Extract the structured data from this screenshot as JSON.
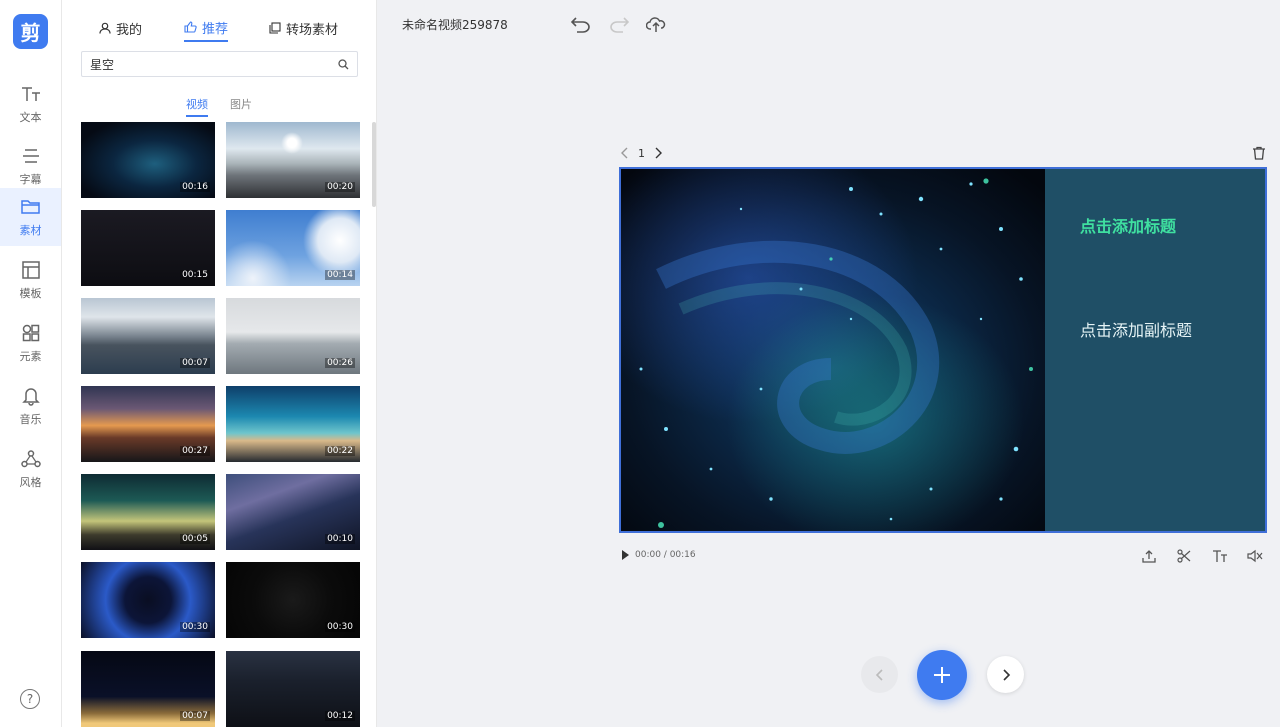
{
  "app": {
    "logo_text": "剪",
    "project_title": "未命名视频259878"
  },
  "rail": {
    "items": [
      {
        "label": "文本",
        "icon": "text-icon"
      },
      {
        "label": "字幕",
        "icon": "subtitle-icon"
      },
      {
        "label": "素材",
        "icon": "folder-icon"
      },
      {
        "label": "模板",
        "icon": "template-icon"
      },
      {
        "label": "元素",
        "icon": "elements-icon"
      },
      {
        "label": "音乐",
        "icon": "bell-icon"
      },
      {
        "label": "风格",
        "icon": "style-icon"
      }
    ],
    "active": "素材",
    "help_icon": "?"
  },
  "panel": {
    "tabs": [
      {
        "label": "我的",
        "icon": "user-icon"
      },
      {
        "label": "推荐",
        "icon": "thumbs-up-icon"
      },
      {
        "label": "转场素材",
        "icon": "copy-icon"
      }
    ],
    "active_tab": "推荐",
    "search": {
      "value": "星空",
      "placeholder": ""
    },
    "subtabs": [
      "视频",
      "图片"
    ],
    "active_subtab": "视频",
    "thumbnails": [
      {
        "duration": "00:16",
        "scene": "galaxy"
      },
      {
        "duration": "00:20",
        "scene": "sun-lake"
      },
      {
        "duration": "00:15",
        "scene": "dark"
      },
      {
        "duration": "00:14",
        "scene": "blue-sky"
      },
      {
        "duration": "00:07",
        "scene": "city-harbor"
      },
      {
        "duration": "00:26",
        "scene": "grey-sea"
      },
      {
        "duration": "00:27",
        "scene": "sunset-clouds"
      },
      {
        "duration": "00:22",
        "scene": "teal-horizon"
      },
      {
        "duration": "00:05",
        "scene": "night-city-glow"
      },
      {
        "duration": "00:10",
        "scene": "milky-way-coast"
      },
      {
        "duration": "00:30",
        "scene": "warp-blue"
      },
      {
        "duration": "00:30",
        "scene": "warp-dark"
      },
      {
        "duration": "00:07",
        "scene": "night-building"
      },
      {
        "duration": "00:12",
        "scene": "night-hill"
      }
    ]
  },
  "canvas": {
    "page_number": "1",
    "title_placeholder": "点击添加标题",
    "subtitle_placeholder": "点击添加副标题",
    "time": "00:00 / 00:16"
  },
  "colors": {
    "accent": "#3f7bf0",
    "title_green": "#3fe0a0",
    "panel_teal": "#1f4f66"
  }
}
